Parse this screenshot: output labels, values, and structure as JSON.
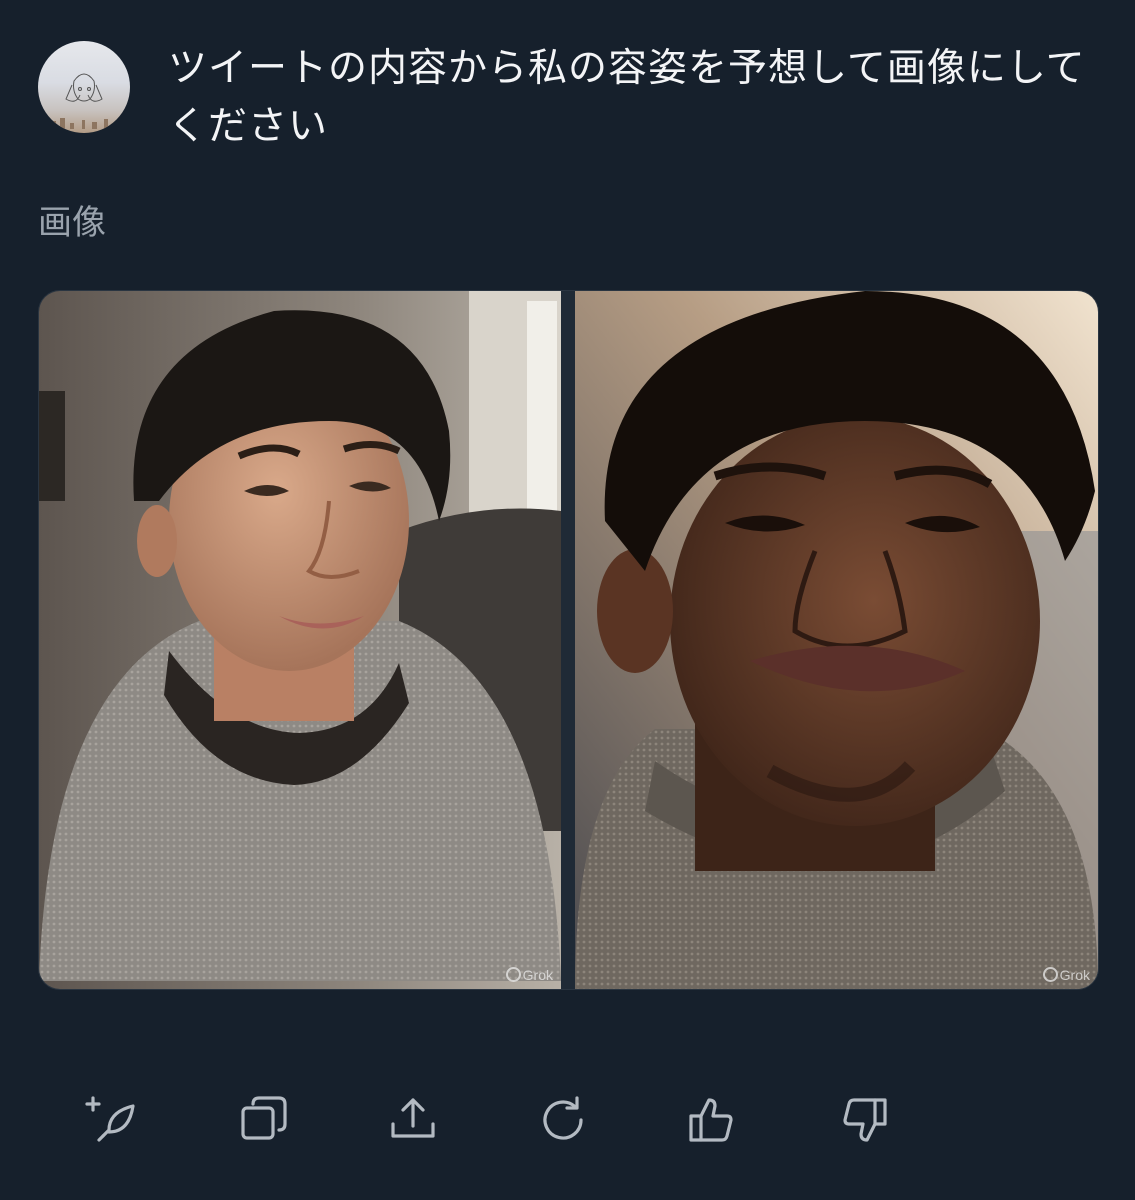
{
  "message": {
    "prompt": "ツイートの内容から私の容姿を予想して画像にしてください"
  },
  "section": {
    "label": "画像"
  },
  "images": [
    {
      "watermark": "Grok"
    },
    {
      "watermark": "Grok"
    }
  ],
  "actions": [
    {
      "icon": "new-post-icon"
    },
    {
      "icon": "copy-icon"
    },
    {
      "icon": "share-icon"
    },
    {
      "icon": "regenerate-icon"
    },
    {
      "icon": "thumbs-up-icon"
    },
    {
      "icon": "thumbs-down-icon"
    }
  ],
  "colors": {
    "background": "#16202c",
    "text": "#f3f4f6",
    "muted": "#9aa3ad",
    "icon": "#b3bac2"
  }
}
